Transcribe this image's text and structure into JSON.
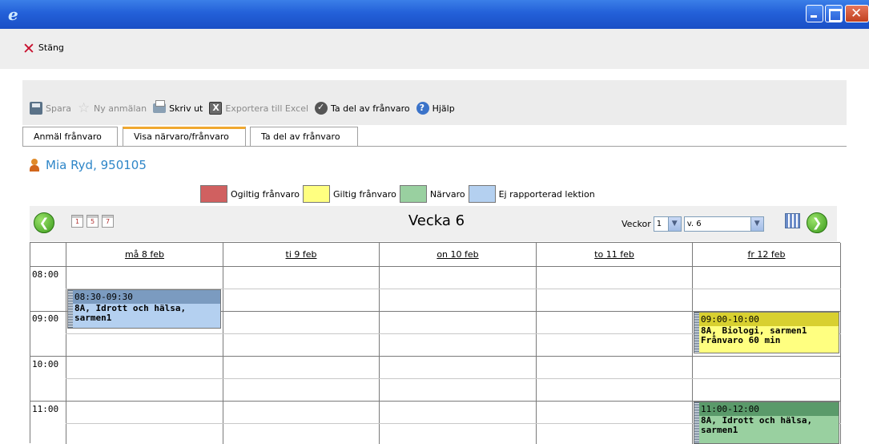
{
  "window": {
    "icon": "ie-icon"
  },
  "close": {
    "label": "Stäng"
  },
  "toolbar": {
    "save": "Spara",
    "new_report": "Ny anmälan",
    "print": "Skriv ut",
    "export": "Exportera till Excel",
    "take_part": "Ta del av frånvaro",
    "help": "Hjälp"
  },
  "tabs": [
    "Anmäl frånvaro",
    "Visa närvaro/frånvaro",
    "Ta del av frånvaro"
  ],
  "active_tab": 1,
  "student": {
    "name": "Mia Ryd,  950105"
  },
  "legend": [
    {
      "label": "Ogiltig frånvaro",
      "color": "#d06060"
    },
    {
      "label": "Giltig frånvaro",
      "color": "#ffff80"
    },
    {
      "label": "Närvaro",
      "color": "#99d0a0"
    },
    {
      "label": "Ej rapporterad lektion",
      "color": "#b4d0f0"
    }
  ],
  "calendar": {
    "title": "Vecka 6",
    "view_icons": [
      "1",
      "5",
      "7"
    ],
    "weeks_label": "Veckor",
    "weeks_value": "1",
    "week_value": "v. 6",
    "days": [
      "må 8 feb",
      "ti 9 feb",
      "on 10 feb",
      "to 11 feb",
      "fr 12 feb"
    ],
    "times": [
      "08:00",
      "09:00",
      "10:00",
      "11:00"
    ],
    "events": [
      {
        "day": 0,
        "time": "08:30-09:30",
        "text": "8A, Idrott och hälsa, sarmen1",
        "color": "#b4d0f0",
        "head_color": "#7b9bc0"
      },
      {
        "day": 4,
        "time": "09:00-10:00",
        "text": "8A, Biologi, sarmen1 Frånvaro 60 min",
        "color": "#ffff80",
        "head_color": "#d8d030"
      },
      {
        "day": 4,
        "time": "11:00-12:00",
        "text": "8A, Idrott och hälsa, sarmen1",
        "color": "#99d0a0",
        "head_color": "#5a9a6a"
      }
    ]
  }
}
